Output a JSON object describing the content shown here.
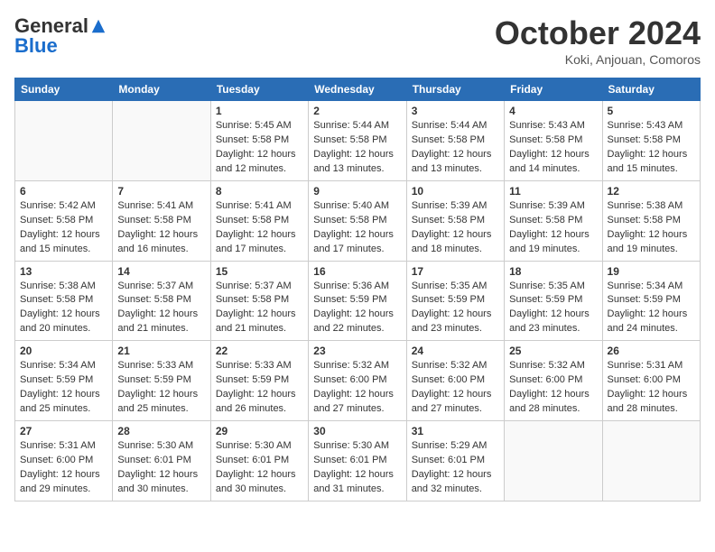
{
  "header": {
    "logo_general": "General",
    "logo_blue": "Blue",
    "month": "October 2024",
    "location": "Koki, Anjouan, Comoros"
  },
  "days_of_week": [
    "Sunday",
    "Monday",
    "Tuesday",
    "Wednesday",
    "Thursday",
    "Friday",
    "Saturday"
  ],
  "weeks": [
    [
      {
        "day": "",
        "empty": true
      },
      {
        "day": "",
        "empty": true
      },
      {
        "day": "1",
        "sunrise": "Sunrise: 5:45 AM",
        "sunset": "Sunset: 5:58 PM",
        "daylight": "Daylight: 12 hours and 12 minutes."
      },
      {
        "day": "2",
        "sunrise": "Sunrise: 5:44 AM",
        "sunset": "Sunset: 5:58 PM",
        "daylight": "Daylight: 12 hours and 13 minutes."
      },
      {
        "day": "3",
        "sunrise": "Sunrise: 5:44 AM",
        "sunset": "Sunset: 5:58 PM",
        "daylight": "Daylight: 12 hours and 13 minutes."
      },
      {
        "day": "4",
        "sunrise": "Sunrise: 5:43 AM",
        "sunset": "Sunset: 5:58 PM",
        "daylight": "Daylight: 12 hours and 14 minutes."
      },
      {
        "day": "5",
        "sunrise": "Sunrise: 5:43 AM",
        "sunset": "Sunset: 5:58 PM",
        "daylight": "Daylight: 12 hours and 15 minutes."
      }
    ],
    [
      {
        "day": "6",
        "sunrise": "Sunrise: 5:42 AM",
        "sunset": "Sunset: 5:58 PM",
        "daylight": "Daylight: 12 hours and 15 minutes."
      },
      {
        "day": "7",
        "sunrise": "Sunrise: 5:41 AM",
        "sunset": "Sunset: 5:58 PM",
        "daylight": "Daylight: 12 hours and 16 minutes."
      },
      {
        "day": "8",
        "sunrise": "Sunrise: 5:41 AM",
        "sunset": "Sunset: 5:58 PM",
        "daylight": "Daylight: 12 hours and 17 minutes."
      },
      {
        "day": "9",
        "sunrise": "Sunrise: 5:40 AM",
        "sunset": "Sunset: 5:58 PM",
        "daylight": "Daylight: 12 hours and 17 minutes."
      },
      {
        "day": "10",
        "sunrise": "Sunrise: 5:39 AM",
        "sunset": "Sunset: 5:58 PM",
        "daylight": "Daylight: 12 hours and 18 minutes."
      },
      {
        "day": "11",
        "sunrise": "Sunrise: 5:39 AM",
        "sunset": "Sunset: 5:58 PM",
        "daylight": "Daylight: 12 hours and 19 minutes."
      },
      {
        "day": "12",
        "sunrise": "Sunrise: 5:38 AM",
        "sunset": "Sunset: 5:58 PM",
        "daylight": "Daylight: 12 hours and 19 minutes."
      }
    ],
    [
      {
        "day": "13",
        "sunrise": "Sunrise: 5:38 AM",
        "sunset": "Sunset: 5:58 PM",
        "daylight": "Daylight: 12 hours and 20 minutes."
      },
      {
        "day": "14",
        "sunrise": "Sunrise: 5:37 AM",
        "sunset": "Sunset: 5:58 PM",
        "daylight": "Daylight: 12 hours and 21 minutes."
      },
      {
        "day": "15",
        "sunrise": "Sunrise: 5:37 AM",
        "sunset": "Sunset: 5:58 PM",
        "daylight": "Daylight: 12 hours and 21 minutes."
      },
      {
        "day": "16",
        "sunrise": "Sunrise: 5:36 AM",
        "sunset": "Sunset: 5:59 PM",
        "daylight": "Daylight: 12 hours and 22 minutes."
      },
      {
        "day": "17",
        "sunrise": "Sunrise: 5:35 AM",
        "sunset": "Sunset: 5:59 PM",
        "daylight": "Daylight: 12 hours and 23 minutes."
      },
      {
        "day": "18",
        "sunrise": "Sunrise: 5:35 AM",
        "sunset": "Sunset: 5:59 PM",
        "daylight": "Daylight: 12 hours and 23 minutes."
      },
      {
        "day": "19",
        "sunrise": "Sunrise: 5:34 AM",
        "sunset": "Sunset: 5:59 PM",
        "daylight": "Daylight: 12 hours and 24 minutes."
      }
    ],
    [
      {
        "day": "20",
        "sunrise": "Sunrise: 5:34 AM",
        "sunset": "Sunset: 5:59 PM",
        "daylight": "Daylight: 12 hours and 25 minutes."
      },
      {
        "day": "21",
        "sunrise": "Sunrise: 5:33 AM",
        "sunset": "Sunset: 5:59 PM",
        "daylight": "Daylight: 12 hours and 25 minutes."
      },
      {
        "day": "22",
        "sunrise": "Sunrise: 5:33 AM",
        "sunset": "Sunset: 5:59 PM",
        "daylight": "Daylight: 12 hours and 26 minutes."
      },
      {
        "day": "23",
        "sunrise": "Sunrise: 5:32 AM",
        "sunset": "Sunset: 6:00 PM",
        "daylight": "Daylight: 12 hours and 27 minutes."
      },
      {
        "day": "24",
        "sunrise": "Sunrise: 5:32 AM",
        "sunset": "Sunset: 6:00 PM",
        "daylight": "Daylight: 12 hours and 27 minutes."
      },
      {
        "day": "25",
        "sunrise": "Sunrise: 5:32 AM",
        "sunset": "Sunset: 6:00 PM",
        "daylight": "Daylight: 12 hours and 28 minutes."
      },
      {
        "day": "26",
        "sunrise": "Sunrise: 5:31 AM",
        "sunset": "Sunset: 6:00 PM",
        "daylight": "Daylight: 12 hours and 28 minutes."
      }
    ],
    [
      {
        "day": "27",
        "sunrise": "Sunrise: 5:31 AM",
        "sunset": "Sunset: 6:00 PM",
        "daylight": "Daylight: 12 hours and 29 minutes."
      },
      {
        "day": "28",
        "sunrise": "Sunrise: 5:30 AM",
        "sunset": "Sunset: 6:01 PM",
        "daylight": "Daylight: 12 hours and 30 minutes."
      },
      {
        "day": "29",
        "sunrise": "Sunrise: 5:30 AM",
        "sunset": "Sunset: 6:01 PM",
        "daylight": "Daylight: 12 hours and 30 minutes."
      },
      {
        "day": "30",
        "sunrise": "Sunrise: 5:30 AM",
        "sunset": "Sunset: 6:01 PM",
        "daylight": "Daylight: 12 hours and 31 minutes."
      },
      {
        "day": "31",
        "sunrise": "Sunrise: 5:29 AM",
        "sunset": "Sunset: 6:01 PM",
        "daylight": "Daylight: 12 hours and 32 minutes."
      },
      {
        "day": "",
        "empty": true
      },
      {
        "day": "",
        "empty": true
      }
    ]
  ]
}
